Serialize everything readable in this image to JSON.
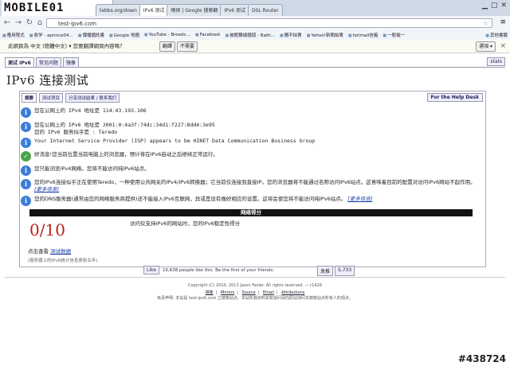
{
  "browser": {
    "logo": "MOBILE01",
    "tabs": [
      "tebbs.org/down",
      "IPv6 测试",
      "嗅探 | Google 搜索翻",
      "IPv6 测试",
      "DSL Router"
    ],
    "url": "test-ipv6.com",
    "bookmarks": [
      "應用程式",
      "收学 - aprince04...",
      "傳播圖託書",
      "Google 地圖",
      "YouTube - Broadc...",
      "Facebook",
      "被館難燒鐘錢 - Battl...",
      "攤不拍賣",
      "Yahoo!新聞拍賣",
      "hotmail信箱",
      "一般電一",
      "其他書籤"
    ],
    "translate_text": "此網頁為 中文 (簡體中文) ▾ 您要翻譯網頁內容嗎？",
    "translate_lang": "中文 (簡體中文) ▾",
    "translate_button": "翻譯",
    "no_translate_button": "不需要",
    "options_button": "選項 ▾"
  },
  "page": {
    "top_tabs": [
      "测试 IPv6",
      "常见问题",
      "镜像"
    ],
    "stats_tab": "stats",
    "title": "IPv6 连接测试",
    "panel_tabs": [
      "摘要",
      "测试项目",
      "分享测试结果 / 联系我们"
    ],
    "help_link": "For the Help Desk",
    "results": [
      {
        "icon": "info",
        "text": "您在公网上的 IPv4 地址是 114.43.193.106"
      },
      {
        "icon": "info",
        "text": "您在公网上的 IPv6 地址是 2001:0:4a3f:74dc:34d1:f227:8dd4:3e95"
      },
      {
        "icon": "info",
        "text": "您的 IPv6 服务似乎是 : Teredo"
      },
      {
        "icon": "info",
        "text": "Your Internet Service Provider (ISP) appears to be HINET Data Communication Business Group"
      },
      {
        "icon": "ok",
        "text": "好消息!您当前位置当前电脑上的浏览器，预计将在IPv6启动之后继续正常运行。"
      },
      {
        "icon": "info",
        "text": "您只能浏览IPv4网络。您将不能访问纯IPv6站点。"
      },
      {
        "icon": "info",
        "text": "您的IPv6连接似乎正在使用Teredo，一种使用公共网关的IPv4/IPv6转换器；它当前仅连接到直接IP。您的浏览器将不能通过名称访问IPv6站点。这意味着目前的配置对访问IPv6网站不起作用。"
      },
      {
        "icon": "info",
        "text": "您的DNS服务器(通常由您的网络服务商提供)还不能接入IPv6互联网，异或是设有做好相应的设置。这将会使您将不能访问纯IPv6站点。"
      }
    ],
    "more_info": "[更多信息]",
    "score_title": "网络得分",
    "score": "0/10",
    "score_desc": "访问仅支持IPv6的网站时，您的IPv6稳定性得分",
    "click_prefix": "点击查看",
    "click_link": "测试数据",
    "note": "(服务器上的IPv6统计信息更新五年)",
    "fb_like": "Like",
    "fb_text": "16,638 people like this. Be the first of your friends.",
    "share_label": "发推",
    "share_count": "5,733",
    "copyright": "Copyright (C) 2010, 2013 Jason Fesler. All rights reserved. — r1428",
    "footer_links": [
      "镜像",
      "Mirrors",
      "Source",
      "Email",
      "Attributions"
    ],
    "disclaimer": "免责声明: 本站是 test-ipv6.com 之镜像站点。本站所载资料如有疑问请向原站询问本镜像站点所有人的观点。",
    "watermark": "#438724"
  }
}
